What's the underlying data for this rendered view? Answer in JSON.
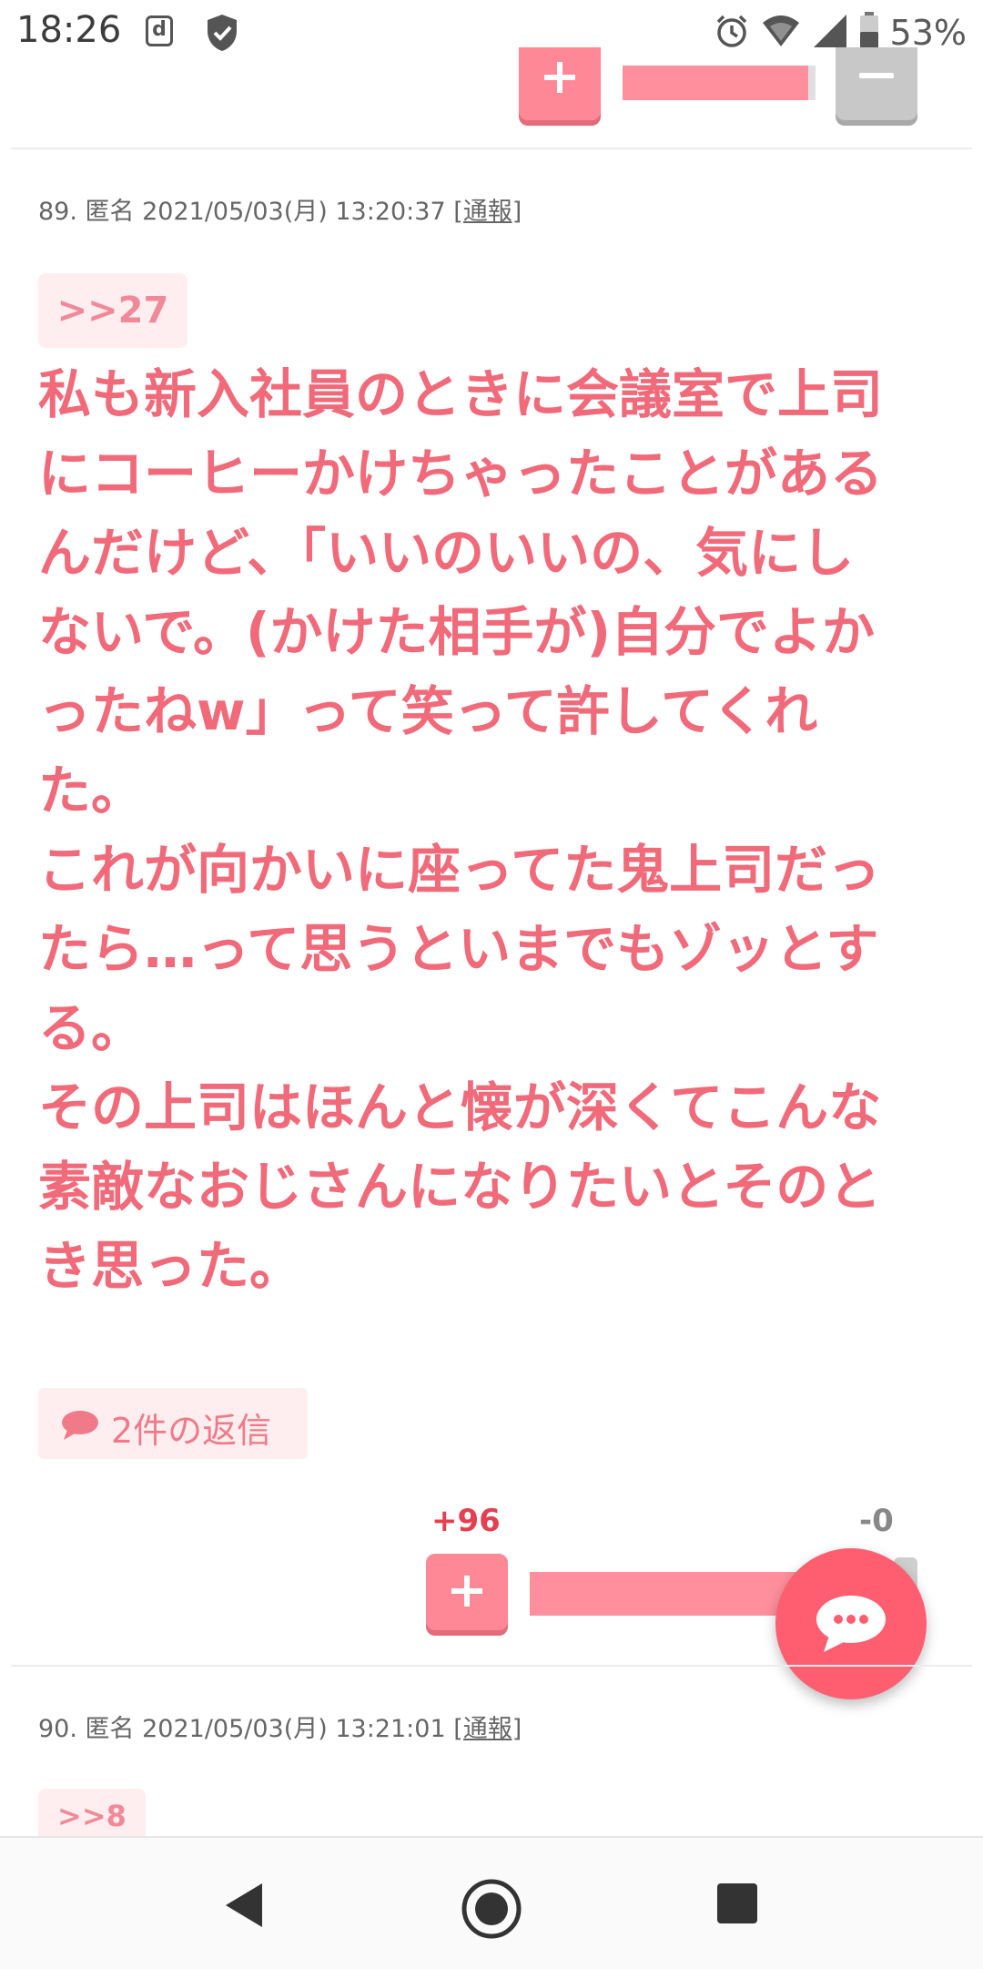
{
  "status_bar": {
    "time": "18:26",
    "battery": "53%",
    "icons": [
      "d-icon",
      "shield-check-icon",
      "alarm-icon",
      "wifi-icon",
      "signal-icon",
      "battery-icon"
    ]
  },
  "posts": [
    {
      "meta": "89. 匿名 2021/05/03(月) 13:20:37",
      "report": "[通報]",
      "anchor": ">>27",
      "lines": [
        "私も新入社員のときに会議室で上司",
        "にコーヒーかけちゃったことがある",
        "んだけど、「いいのいいの、気にし",
        "ないで。(かけた相手が)自分でよか",
        "ったねw」って笑って許してくれ",
        "た。",
        "これが向かいに座ってた鬼上司だっ",
        "たら…って思うといまでもゾッとす",
        "る。",
        "その上司はほんと懐が深くてこんな",
        "素敵なおじさんになりたいとそのと",
        "き思った。"
      ],
      "replies": "2件の返信",
      "plus_score": "+96",
      "minus_score": "-0"
    },
    {
      "meta": "90. 匿名 2021/05/03(月) 13:21:01",
      "report": "[通報]",
      "anchor": ">>8"
    }
  ],
  "colors": {
    "accent": "#f06a7a",
    "vote_plus": "#ff8896",
    "fab": "#ff5e70"
  }
}
